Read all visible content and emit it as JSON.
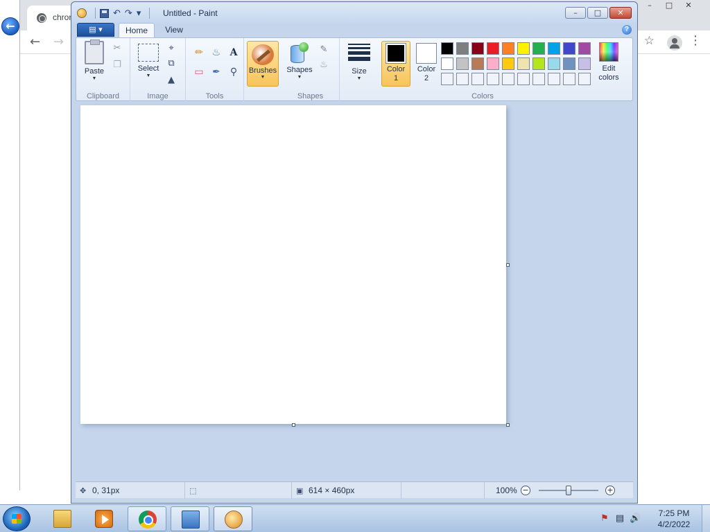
{
  "browser": {
    "tab_title": "chron",
    "window_controls": [
      "–",
      "□",
      "✕"
    ]
  },
  "paint": {
    "window_title": "Untitled - Paint",
    "window_controls": {
      "minimize": "–",
      "maximize": "□",
      "close": "✕"
    },
    "file_menu_label": "▤ ▾",
    "tabs": [
      {
        "label": "Home",
        "active": true
      },
      {
        "label": "View",
        "active": false
      }
    ],
    "help_label": "?",
    "ribbon": {
      "clipboard": {
        "label": "Clipboard",
        "paste": "Paste"
      },
      "image": {
        "label": "Image",
        "select": "Select"
      },
      "tools": {
        "label": "Tools",
        "text_tool": "A"
      },
      "brushes": {
        "label": "Brushes"
      },
      "shapes": {
        "label": "Shapes",
        "shapes_button": "Shapes"
      },
      "size": {
        "label": "Size"
      },
      "colors": {
        "label": "Colors",
        "color1_line1": "Color",
        "color1_line2": "1",
        "color1_value": "#000000",
        "color2_line1": "Color",
        "color2_line2": "2",
        "color2_value": "#ffffff",
        "edit_line1": "Edit",
        "edit_line2": "colors",
        "palette": [
          "#000000",
          "#7f7f7f",
          "#880015",
          "#ed1c24",
          "#ff7f27",
          "#fff200",
          "#22b14c",
          "#00a2e8",
          "#3f48cc",
          "#a349a4",
          "#ffffff",
          "#c3c3c3",
          "#b97a57",
          "#ffaec9",
          "#ffc90e",
          "#efe4b0",
          "#b5e61d",
          "#99d9ea",
          "#7092be",
          "#c8bfe7",
          "#f0f4fa",
          "#f0f4fa",
          "#f0f4fa",
          "#f0f4fa",
          "#f0f4fa",
          "#f0f4fa",
          "#f0f4fa",
          "#f0f4fa",
          "#f0f4fa",
          "#f0f4fa"
        ]
      }
    },
    "canvas": {
      "background": "#ffffff"
    },
    "status": {
      "cursor_position": "0, 31px",
      "selection_size": "",
      "image_size": "614 × 460px",
      "zoom": "100%",
      "zoom_fraction": 0.5
    }
  },
  "taskbar": {
    "items": [
      "Windows Explorer",
      "Windows Media Player",
      "Google Chrome",
      "Control Panel",
      "Paint"
    ],
    "clock": {
      "time": "7:25 PM",
      "date": "4/2/2022"
    }
  }
}
